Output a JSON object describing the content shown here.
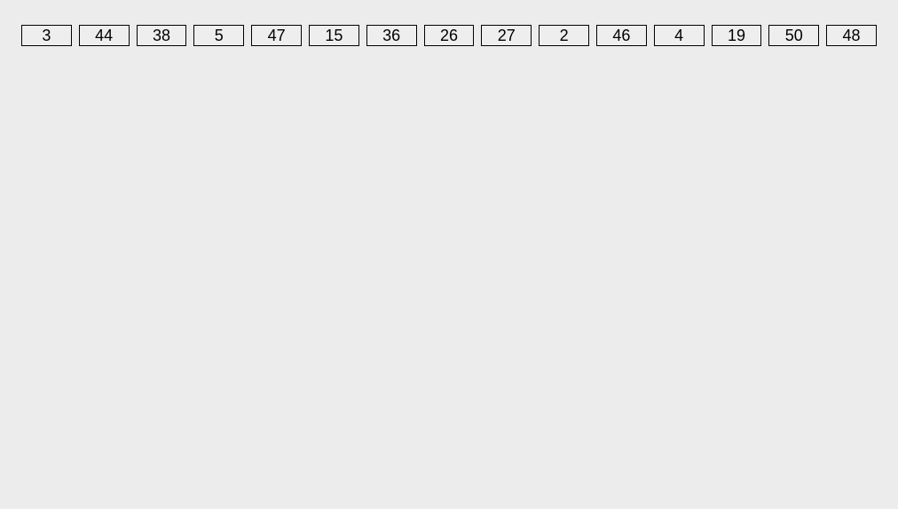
{
  "numbers": [
    3,
    44,
    38,
    5,
    47,
    15,
    36,
    26,
    27,
    2,
    46,
    4,
    19,
    50,
    48
  ]
}
